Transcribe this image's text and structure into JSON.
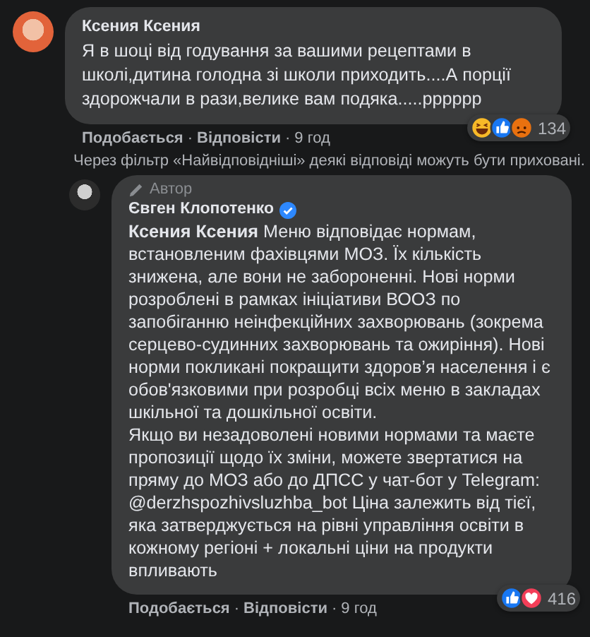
{
  "comment": {
    "author": "Ксения Ксения",
    "text": "Я в шоці від годування за вашими рецептами в школі,дитина голодна зі школи приходить....А порції здорожчали в рази,велике вам подяка.....рррррр",
    "reactions": [
      {
        "kind": "haha"
      },
      {
        "kind": "like"
      },
      {
        "kind": "angry"
      }
    ],
    "reaction_count": "134",
    "like": "Подобається",
    "reply": "Відповісти",
    "separator": "·",
    "time": "9 год"
  },
  "filter_note": "Через фільтр «Найвідповідніші» деякі відповіді можуть бути приховані.",
  "reply": {
    "badge": "Автор",
    "author": "Євген Клопотенко",
    "verified": true,
    "paragraphs": [
      "**Ксения Ксения** Меню відповідає нормам, встановленим фахівцями МОЗ. Їх кількість знижена, але вони не забороненні. Нові норми розроблені в рамках ініціативи ВООЗ по запобіганню неінфекційних захворювань (зокрема серцево-судинних захворювань та ожиріння). Нові норми покликані покращити здоров’я населення і є обов'язковими при розробці всіх меню в закладах шкільної та дошкільної освіти.",
      "Якщо ви незадоволені новими нормами та маєте пропозиції щодо їх зміни, можете звертатися на пряму до МОЗ або до ДПСС у чат-бот у Telegram: @derzhspozhivsluzhba_bot Ціна залежить від тієї, яка затверджується на рівні управління освіти в кожному регіоні + локальні ціни на продукти впливають"
    ],
    "reactions": [
      {
        "kind": "like"
      },
      {
        "kind": "love"
      }
    ],
    "reaction_count": "416",
    "like": "Подобається",
    "reply": "Відповісти",
    "separator": "·",
    "time": "9 год"
  }
}
